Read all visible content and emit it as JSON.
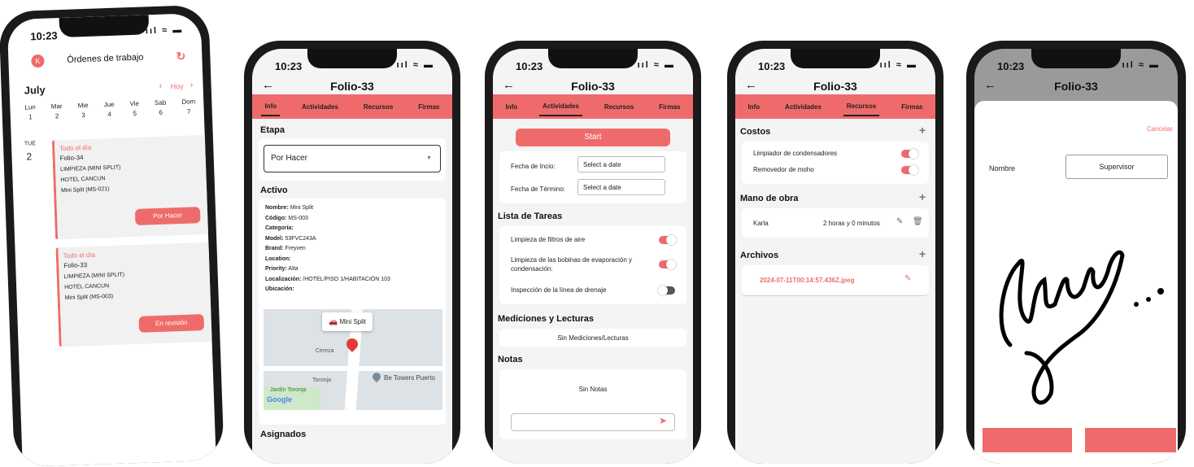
{
  "status": {
    "time": "10:23",
    "icons": "ııl ≈ ▬"
  },
  "p1": {
    "avatar": "K",
    "title": "Órdenes de trabajo",
    "month": "July",
    "today": "Hoy",
    "days": [
      {
        "n": "Lun",
        "d": "1"
      },
      {
        "n": "Mar",
        "d": "2"
      },
      {
        "n": "Mie",
        "d": "3"
      },
      {
        "n": "Jue",
        "d": "4"
      },
      {
        "n": "Vie",
        "d": "5"
      },
      {
        "n": "Sab",
        "d": "6"
      },
      {
        "n": "Dom",
        "d": "7"
      }
    ],
    "dayLabel": "TUE",
    "dayNum": "2",
    "events": [
      {
        "allday": "Todo el día",
        "folio": "Folio-34",
        "line1": "LIMPIEZA (MINI SPLIT)",
        "line2": "HOTEL CANCUN",
        "line3": "Mini Split (MS-021)",
        "button": "Por Hacer"
      },
      {
        "allday": "Todo el día",
        "folio": "Folio-33",
        "line1": "LIMPIEZA (MINI SPLIT)",
        "line2": "HOTEL CANCUN",
        "line3": "Mini Split (MS-003)",
        "button": "En revisión"
      }
    ]
  },
  "folio": "Folio-33",
  "tabs": [
    "Info",
    "Actividades",
    "Recursos",
    "Firmas"
  ],
  "p2": {
    "etapa": "Etapa",
    "etapaValue": "Por Hacer",
    "activo": "Activo",
    "fields": [
      {
        "k": "Nombre:",
        "v": " Mini Split"
      },
      {
        "k": "Código:",
        "v": " MS-003"
      },
      {
        "k": "Categoría:",
        "v": ""
      },
      {
        "k": "Model:",
        "v": " 53FVC243A"
      },
      {
        "k": "Brand:",
        "v": " Freyven"
      },
      {
        "k": "Location:",
        "v": ""
      },
      {
        "k": "Priority:",
        "v": " Alta"
      },
      {
        "k": "Localización:",
        "v": " /HOTEL/PISO 1/HABITACIÓN 103"
      },
      {
        "k": "Ubicación:",
        "v": ""
      }
    ],
    "mapPin": "Mini Split",
    "map1": "Cereza",
    "map2": "Toronja",
    "map3": "Be Towers Puerto",
    "map4": "Jardín Toronja",
    "google": "Google",
    "asignados": "Asignados"
  },
  "p3": {
    "start": "Start",
    "fInicio": "Fecha de Incio:",
    "fTermino": "Fecha de Término:",
    "datePh": "Select a date",
    "lista": "Lista de Tareas",
    "tasks": [
      {
        "label": "Limpieza de filtros de aire",
        "on": true
      },
      {
        "label": "Limpieza de las bobinas de evaporación y condensación:",
        "on": true
      },
      {
        "label": "Inspección de la línea de drenaje",
        "on": false
      }
    ],
    "mediciones": "Mediciones y Lecturas",
    "sinMed": "Sin Mediciones/Lecturas",
    "notas": "Notas",
    "sinNotas": "Sin Notas"
  },
  "p4": {
    "costos": "Costos",
    "items": [
      "Limpiador de condensadores",
      "Removedor de moho"
    ],
    "mano": "Mano de obra",
    "worker": "Karla",
    "hours": "2 horas y 0 minutos",
    "archivos": "Archivos",
    "file": "2024-07-11T00:14:57.436Z.jpeg"
  },
  "p5": {
    "cancel": "Cancelar",
    "nombre": "Nombre",
    "value": "Supervisor"
  },
  "colors": {
    "accent": "#ef6b6b"
  }
}
